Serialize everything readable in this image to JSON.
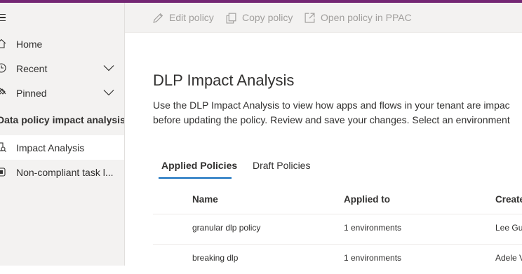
{
  "colors": {
    "brand": "#742774",
    "accent": "#0f6cbd",
    "disabled_text": "#a19f9d"
  },
  "sidebar": {
    "menu_icon": "hamburger-icon",
    "items": [
      {
        "label": "Home",
        "icon": "home-icon"
      },
      {
        "label": "Recent",
        "icon": "clock-icon",
        "expandable": true
      },
      {
        "label": "Pinned",
        "icon": "pin-icon",
        "expandable": true
      }
    ],
    "section_title": "Data policy impact analysis",
    "section_items": [
      {
        "label": "Impact Analysis",
        "icon": "impact-analysis-icon",
        "selected": true
      },
      {
        "label": "Non-compliant task l...",
        "icon": "task-list-icon",
        "selected": false
      }
    ]
  },
  "commandbar": {
    "edit_label": "Edit policy",
    "copy_label": "Copy policy",
    "open_label": "Open policy in PPAC"
  },
  "main": {
    "title": "DLP Impact Analysis",
    "description_line1": "Use the DLP Impact Analysis to view how apps and flows in your tenant are impac",
    "description_line2": "before updating the policy. Review and save your changes. Select an environment",
    "tabs": [
      {
        "label": "Applied Policies",
        "active": true
      },
      {
        "label": "Draft Policies",
        "active": false
      }
    ],
    "table": {
      "columns": [
        "Name",
        "Applied to",
        "Create"
      ],
      "rows": [
        {
          "name": "granular dlp policy",
          "applied_to": "1 environments",
          "created_by": "Lee Gu"
        },
        {
          "name": "breaking dlp",
          "applied_to": "1 environments",
          "created_by": "Adele V"
        }
      ]
    }
  }
}
